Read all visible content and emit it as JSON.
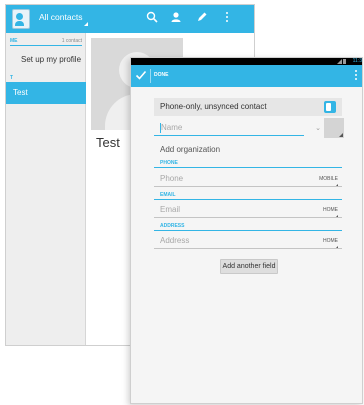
{
  "contacts_window": {
    "title": "All contacts",
    "sidebar": {
      "me_section": {
        "label": "ME",
        "count": "1 contact"
      },
      "setup_profile": "Set up my profile",
      "t_section": {
        "label": "T"
      },
      "selected_contact": "Test"
    },
    "detail": {
      "name": "Test"
    }
  },
  "edit_window": {
    "status": {
      "time": "11:3"
    },
    "action_bar": {
      "done_label": "DONE"
    },
    "account_label": "Phone-only, unsynced contact",
    "name_placeholder": "Name",
    "organization_label": "Add organization",
    "phone": {
      "header": "PHONE",
      "placeholder": "Phone",
      "type": "MOBILE"
    },
    "email": {
      "header": "EMAIL",
      "placeholder": "Email",
      "type": "HOME"
    },
    "address": {
      "header": "ADDRESS",
      "placeholder": "Address",
      "type": "HOME"
    },
    "add_field_label": "Add another field"
  },
  "colors": {
    "accent": "#33b5e5",
    "background": "#f5f5f5"
  },
  "icons": [
    "contacts-app-icon",
    "search-icon",
    "add-contact-icon",
    "edit-icon",
    "overflow-menu-icon",
    "checkmark-icon",
    "account-type-icon",
    "expand-name-icon",
    "contact-photo-icon"
  ]
}
